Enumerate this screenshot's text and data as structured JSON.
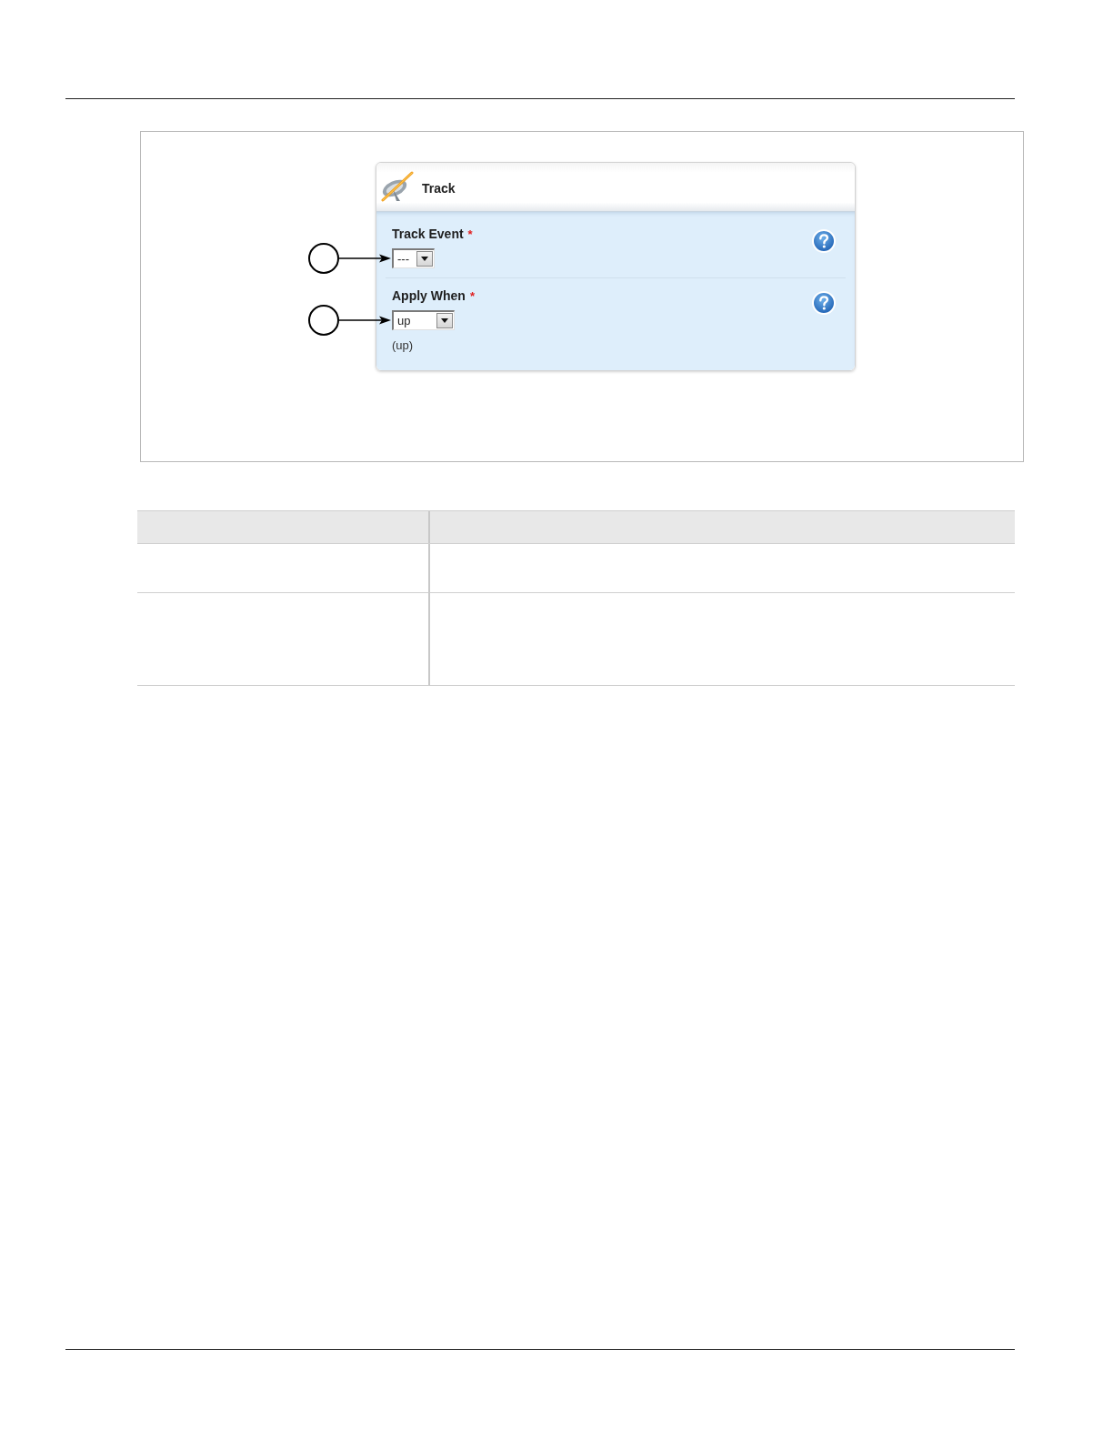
{
  "panel": {
    "title": "Track",
    "fields": [
      {
        "label": "Track Event",
        "required_mark": "*",
        "value": "---",
        "callout": true
      },
      {
        "label": "Apply When",
        "required_mark": "*",
        "value": "up",
        "note": "(up)",
        "callout": true
      }
    ]
  }
}
